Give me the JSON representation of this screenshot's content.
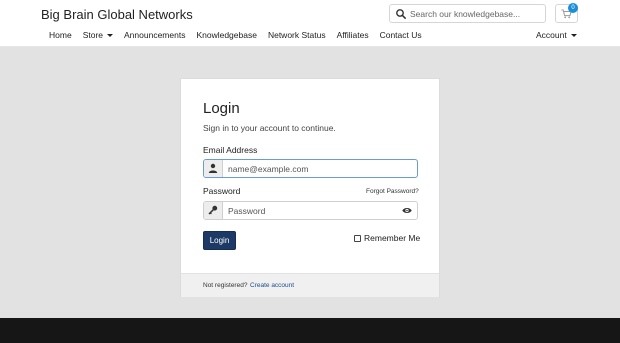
{
  "header": {
    "brand": "Big Brain Global Networks",
    "search_placeholder": "Search our knowledgebase...",
    "cart_count": "0",
    "icons": {
      "search": "search-icon",
      "cart": "cart-icon"
    }
  },
  "nav": {
    "items": [
      {
        "label": "Home"
      },
      {
        "label": "Store",
        "dropdown": true
      },
      {
        "label": "Announcements"
      },
      {
        "label": "Knowledgebase"
      },
      {
        "label": "Network Status"
      },
      {
        "label": "Affiliates"
      },
      {
        "label": "Contact Us"
      }
    ],
    "account_label": "Account"
  },
  "login": {
    "title": "Login",
    "subtitle": "Sign in to your account to continue.",
    "email_label": "Email Address",
    "email_placeholder": "name@example.com",
    "email_value": "",
    "password_label": "Password",
    "password_placeholder": "Password",
    "password_value": "",
    "forgot_label": "Forgot Password?",
    "login_button": "Login",
    "remember_label": "Remember Me",
    "remember_checked": false,
    "not_registered": "Not registered?",
    "create_account": "Create account",
    "icons": {
      "email": "user-icon",
      "password": "key-icon",
      "toggle": "eye-icon"
    }
  },
  "colors": {
    "primary_button": "#1d3a66",
    "link": "#1a4c8a",
    "badge": "#1a8fd8",
    "page_bg": "#e2e2e2",
    "footer_bg": "#161616"
  }
}
